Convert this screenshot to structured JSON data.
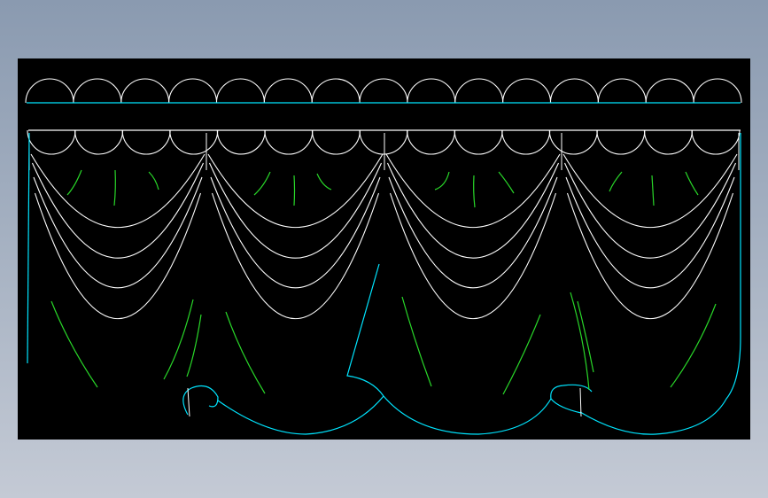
{
  "app": {
    "view": "cad-drawing-viewport"
  },
  "drawing": {
    "subject": "curtain-valance-elevation",
    "colors": {
      "background": "#000000",
      "outline": "#ffffff",
      "edge": "#00e5ff",
      "fold": "#29d829"
    },
    "top_band": {
      "scallop_count": 15
    },
    "valance": {
      "scallop_count": 15,
      "swag_count": 4,
      "swag_rows": 4
    },
    "drape": {
      "panel_count": 4
    }
  }
}
